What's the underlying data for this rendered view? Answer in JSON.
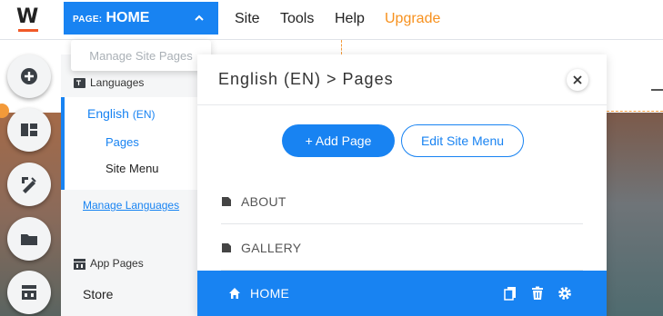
{
  "topbar": {
    "logo_letter": "W",
    "page_prefix": "PAGE:",
    "page_name": "HOME",
    "menus": [
      "Site",
      "Tools",
      "Help",
      "Upgrade"
    ]
  },
  "tooltip": "Manage Site Pages",
  "left_nav": {
    "languages_heading": "Languages",
    "language_name": "English",
    "language_code": "(EN)",
    "sub_items": [
      "Pages",
      "Site Menu"
    ],
    "manage_languages": "Manage Languages",
    "app_pages_heading": "App Pages",
    "store": "Store"
  },
  "panel": {
    "title": "English (EN) > Pages",
    "add_page": "+ Add Page",
    "edit_site_menu": "Edit Site Menu",
    "pages": [
      "ABOUT",
      "GALLERY",
      "HOME"
    ],
    "selected_page": "HOME"
  },
  "colors": {
    "accent": "#1883f2",
    "upgrade": "#f7911e",
    "logo_underline": "#f05a28"
  },
  "icons": {
    "page_row": "page-icon",
    "home_row": "home-icon",
    "row_actions": [
      "duplicate-icon",
      "trash-icon",
      "gear-icon"
    ],
    "tools": [
      "add-icon",
      "layout-icon",
      "design-icon",
      "folder-icon",
      "store-icon"
    ]
  }
}
